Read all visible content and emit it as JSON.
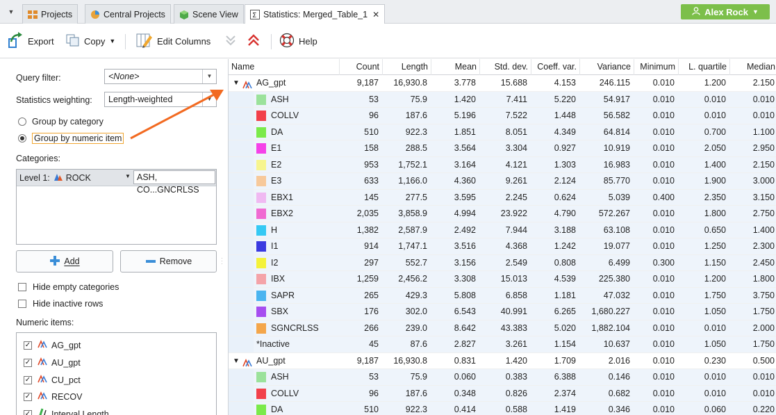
{
  "tabs": [
    {
      "label": "Projects",
      "icon": "projects-icon"
    },
    {
      "label": "Central Projects",
      "icon": "central-projects-icon"
    },
    {
      "label": "Scene View",
      "icon": "scene-view-icon"
    },
    {
      "label": "Statistics: Merged_Table_1",
      "icon": "statistics-icon"
    }
  ],
  "user": {
    "name": "Alex Rock",
    "color": "#7cbf4a"
  },
  "toolbar": {
    "export": "Export",
    "copy": "Copy",
    "edit_columns": "Edit Columns",
    "help": "Help"
  },
  "left": {
    "query_filter_label": "Query filter:",
    "query_filter_value": "<None>",
    "weighting_label": "Statistics weighting:",
    "weighting_value": "Length-weighted",
    "group_category": "Group by category",
    "group_numeric": "Group by numeric item",
    "categories_label": "Categories:",
    "level_label": "Level 1:",
    "level_value": "ROCK",
    "level_filter": "ASH, CO...GNCRLSS",
    "add": "Add",
    "remove": "Remove",
    "hide_empty": "Hide empty categories",
    "hide_inactive": "Hide inactive rows",
    "numeric_label": "Numeric items:",
    "numeric_items": [
      "AG_gpt",
      "AU_gpt",
      "CU_pct",
      "RECOV",
      "Interval Length"
    ]
  },
  "grid": {
    "columns": [
      "Name",
      "Count",
      "Length",
      "Mean",
      "Std. dev.",
      "Coeff. var.",
      "Variance",
      "Minimum",
      "L. quartile",
      "Median"
    ],
    "rows": [
      {
        "kind": "group",
        "name": "AG_gpt",
        "values": [
          "9,187",
          "16,930.8",
          "3.778",
          "15.688",
          "4.153",
          "246.115",
          "0.010",
          "1.200",
          "2.150"
        ]
      },
      {
        "kind": "cat",
        "name": "ASH",
        "color": "#9be29b",
        "values": [
          "53",
          "75.9",
          "1.420",
          "7.411",
          "5.220",
          "54.917",
          "0.010",
          "0.010",
          "0.010"
        ]
      },
      {
        "kind": "cat",
        "name": "COLLV",
        "color": "#f2404a",
        "values": [
          "96",
          "187.6",
          "5.196",
          "7.522",
          "1.448",
          "56.582",
          "0.010",
          "0.010",
          "0.010"
        ]
      },
      {
        "kind": "cat",
        "name": "DA",
        "color": "#7bea4a",
        "values": [
          "510",
          "922.3",
          "1.851",
          "8.051",
          "4.349",
          "64.814",
          "0.010",
          "0.700",
          "1.100"
        ]
      },
      {
        "kind": "cat",
        "name": "E1",
        "color": "#f541e8",
        "values": [
          "158",
          "288.5",
          "3.564",
          "3.304",
          "0.927",
          "10.919",
          "0.010",
          "2.050",
          "2.950"
        ]
      },
      {
        "kind": "cat",
        "name": "E2",
        "color": "#f7f58e",
        "values": [
          "953",
          "1,752.1",
          "3.164",
          "4.121",
          "1.303",
          "16.983",
          "0.010",
          "1.400",
          "2.150"
        ]
      },
      {
        "kind": "cat",
        "name": "E3",
        "color": "#f7c99a",
        "values": [
          "633",
          "1,166.0",
          "4.360",
          "9.261",
          "2.124",
          "85.770",
          "0.010",
          "1.900",
          "3.000"
        ]
      },
      {
        "kind": "cat",
        "name": "EBX1",
        "color": "#f0b9f2",
        "values": [
          "145",
          "277.5",
          "3.595",
          "2.245",
          "0.624",
          "5.039",
          "0.400",
          "2.350",
          "3.150"
        ]
      },
      {
        "kind": "cat",
        "name": "EBX2",
        "color": "#f06ad2",
        "values": [
          "2,035",
          "3,858.9",
          "4.994",
          "23.922",
          "4.790",
          "572.267",
          "0.010",
          "1.800",
          "2.750"
        ]
      },
      {
        "kind": "cat",
        "name": "H",
        "color": "#35c9f4",
        "values": [
          "1,382",
          "2,587.9",
          "2.492",
          "7.944",
          "3.188",
          "63.108",
          "0.010",
          "0.650",
          "1.400"
        ]
      },
      {
        "kind": "cat",
        "name": "I1",
        "color": "#3a3ae0",
        "values": [
          "914",
          "1,747.1",
          "3.516",
          "4.368",
          "1.242",
          "19.077",
          "0.010",
          "1.250",
          "2.300"
        ]
      },
      {
        "kind": "cat",
        "name": "I2",
        "color": "#f4f23a",
        "values": [
          "297",
          "552.7",
          "3.156",
          "2.549",
          "0.808",
          "6.499",
          "0.300",
          "1.150",
          "2.450"
        ]
      },
      {
        "kind": "cat",
        "name": "IBX",
        "color": "#f4a3a8",
        "values": [
          "1,259",
          "2,456.2",
          "3.308",
          "15.013",
          "4.539",
          "225.380",
          "0.010",
          "1.200",
          "1.800"
        ]
      },
      {
        "kind": "cat",
        "name": "SAPR",
        "color": "#4ab4f0",
        "values": [
          "265",
          "429.3",
          "5.808",
          "6.858",
          "1.181",
          "47.032",
          "0.010",
          "1.750",
          "3.750"
        ]
      },
      {
        "kind": "cat",
        "name": "SBX",
        "color": "#a64ef0",
        "values": [
          "176",
          "302.0",
          "6.543",
          "40.991",
          "6.265",
          "1,680.227",
          "0.010",
          "1.050",
          "1.750"
        ]
      },
      {
        "kind": "cat",
        "name": "SGNCRLSS",
        "color": "#f4a64a",
        "values": [
          "266",
          "239.0",
          "8.642",
          "43.383",
          "5.020",
          "1,882.104",
          "0.010",
          "0.010",
          "2.000"
        ]
      },
      {
        "kind": "inactive",
        "name": "*Inactive",
        "values": [
          "45",
          "87.6",
          "2.827",
          "3.261",
          "1.154",
          "10.637",
          "0.010",
          "1.050",
          "1.750"
        ]
      },
      {
        "kind": "group",
        "name": "AU_gpt",
        "values": [
          "9,187",
          "16,930.8",
          "0.831",
          "1.420",
          "1.709",
          "2.016",
          "0.010",
          "0.230",
          "0.500"
        ]
      },
      {
        "kind": "cat",
        "name": "ASH",
        "color": "#9be29b",
        "values": [
          "53",
          "75.9",
          "0.060",
          "0.383",
          "6.388",
          "0.146",
          "0.010",
          "0.010",
          "0.010"
        ]
      },
      {
        "kind": "cat",
        "name": "COLLV",
        "color": "#f2404a",
        "values": [
          "96",
          "187.6",
          "0.348",
          "0.826",
          "2.374",
          "0.682",
          "0.010",
          "0.010",
          "0.010"
        ]
      },
      {
        "kind": "cat",
        "name": "DA",
        "color": "#7bea4a",
        "values": [
          "510",
          "922.3",
          "0.414",
          "0.588",
          "1.419",
          "0.346",
          "0.010",
          "0.060",
          "0.220"
        ]
      }
    ]
  }
}
